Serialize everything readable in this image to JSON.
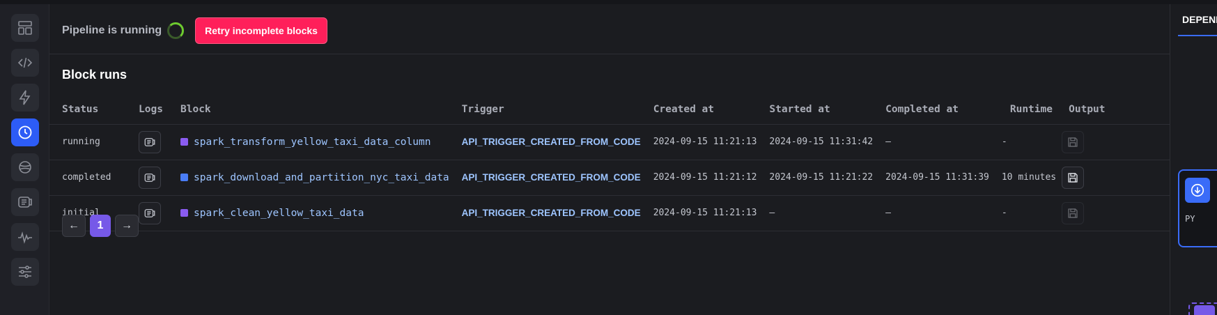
{
  "header": {
    "pipeline_status": "Pipeline is running",
    "retry_label": "Retry incomplete blocks"
  },
  "section": {
    "title": "Block runs"
  },
  "table": {
    "columns": [
      "Status",
      "Logs",
      "Block",
      "Trigger",
      "Created at",
      "Started at",
      "Completed at",
      "Runtime",
      "Output"
    ],
    "rows": [
      {
        "status": "running",
        "block": "spark_transform_yellow_taxi_data_column",
        "block_color": "#8a5cf0",
        "trigger": "API_TRIGGER_CREATED_FROM_CODE",
        "created_at": "2024-09-15 11:21:13",
        "started_at": "2024-09-15 11:31:42",
        "completed_at": "–",
        "runtime": "-"
      },
      {
        "status": "completed",
        "block": "spark_download_and_partition_nyc_taxi_data",
        "block_color": "#4a7df6",
        "trigger": "API_TRIGGER_CREATED_FROM_CODE",
        "created_at": "2024-09-15 11:21:12",
        "started_at": "2024-09-15 11:21:22",
        "completed_at": "2024-09-15 11:31:39",
        "runtime": "10 minutes"
      },
      {
        "status": "initial",
        "block": "spark_clean_yellow_taxi_data",
        "block_color": "#8a5cf0",
        "trigger": "API_TRIGGER_CREATED_FROM_CODE",
        "created_at": "2024-09-15 11:21:13",
        "started_at": "–",
        "completed_at": "–",
        "runtime": "-"
      }
    ]
  },
  "pagination": {
    "prev": "←",
    "current": "1",
    "next": "→"
  },
  "right_panel": {
    "tab": "DEPEND",
    "node_label": "PY"
  },
  "rail": {
    "icons": [
      "layout-icon",
      "code-icon",
      "lightning-icon",
      "clock-icon",
      "planet-icon",
      "logs-icon",
      "pulse-icon",
      "sliders-icon"
    ],
    "active": "clock-icon"
  },
  "colors": {
    "accent": "#2d5cf6",
    "retry": "#ff1f5a",
    "running": "#4ba3ff",
    "completed": "#49c545",
    "page_current": "#7659e8"
  }
}
